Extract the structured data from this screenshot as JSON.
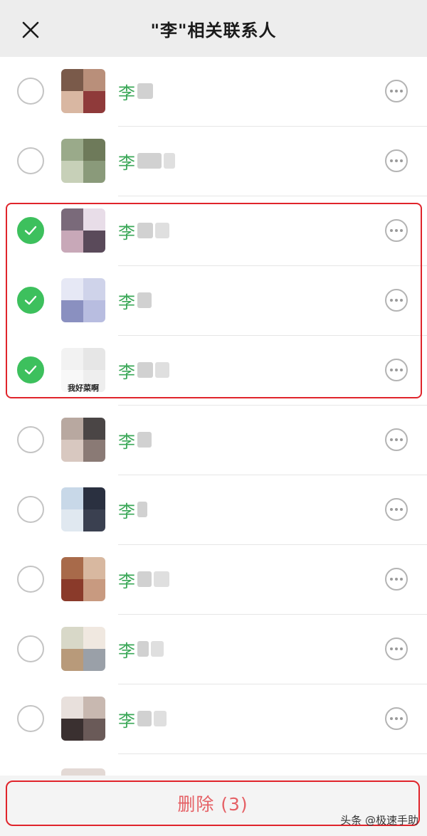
{
  "header": {
    "title": "\"李\"相关联系人",
    "close_icon": "close-icon"
  },
  "contacts": [
    {
      "surname": "李",
      "checked": false,
      "avatar": [
        "#7a5a4a",
        "#b98f7a",
        "#d9b7a2",
        "#8f3a3a"
      ],
      "blurs": [
        22
      ]
    },
    {
      "surname": "李",
      "checked": false,
      "avatar": [
        "#9aaa8a",
        "#6e7a5a",
        "#c7d0b8",
        "#8a9a7a"
      ],
      "blurs": [
        34,
        16
      ]
    },
    {
      "surname": "李",
      "checked": true,
      "avatar": [
        "#7a6a7a",
        "#e8dde8",
        "#c8a8b8",
        "#5a4a5a"
      ],
      "blurs": [
        22,
        20
      ]
    },
    {
      "surname": "李",
      "checked": true,
      "avatar": [
        "#e6e8f5",
        "#cfd3ea",
        "#8a90c0",
        "#b8bde0"
      ],
      "blurs": [
        20
      ]
    },
    {
      "surname": "李",
      "checked": true,
      "avatar": [
        "#f2f2f2",
        "#e6e6e6",
        "#f8f8f8",
        "#eeeeee"
      ],
      "blurs": [
        22,
        20
      ],
      "caption": "我好菜啊"
    },
    {
      "surname": "李",
      "checked": false,
      "avatar": [
        "#b8a8a0",
        "#4a4545",
        "#d8c8c0",
        "#8a7a75"
      ],
      "blurs": [
        20
      ]
    },
    {
      "surname": "李",
      "checked": false,
      "avatar": [
        "#c8d8e8",
        "#2a3040",
        "#e0e8f0",
        "#3a4050"
      ],
      "blurs": [
        14
      ]
    },
    {
      "surname": "李",
      "checked": false,
      "avatar": [
        "#a86a4a",
        "#d8b8a0",
        "#8a3a2a",
        "#c89a80"
      ],
      "blurs": [
        20,
        22
      ]
    },
    {
      "surname": "李",
      "checked": false,
      "avatar": [
        "#d8d8c8",
        "#f0e8e0",
        "#b89a7a",
        "#9aa0a8"
      ],
      "blurs": [
        16,
        18
      ]
    },
    {
      "surname": "李",
      "checked": false,
      "avatar": [
        "#e8e0dc",
        "#c8b8b0",
        "#3a3030",
        "#6a5a58"
      ],
      "blurs": [
        20,
        18
      ]
    }
  ],
  "footer": {
    "delete_label": "删除 (3)"
  },
  "watermark": "头条 @极速手助",
  "colors": {
    "accent_green": "#3dc05d",
    "name_green": "#3aa757",
    "annotation_red": "#e0242b",
    "delete_text": "#e56065"
  }
}
